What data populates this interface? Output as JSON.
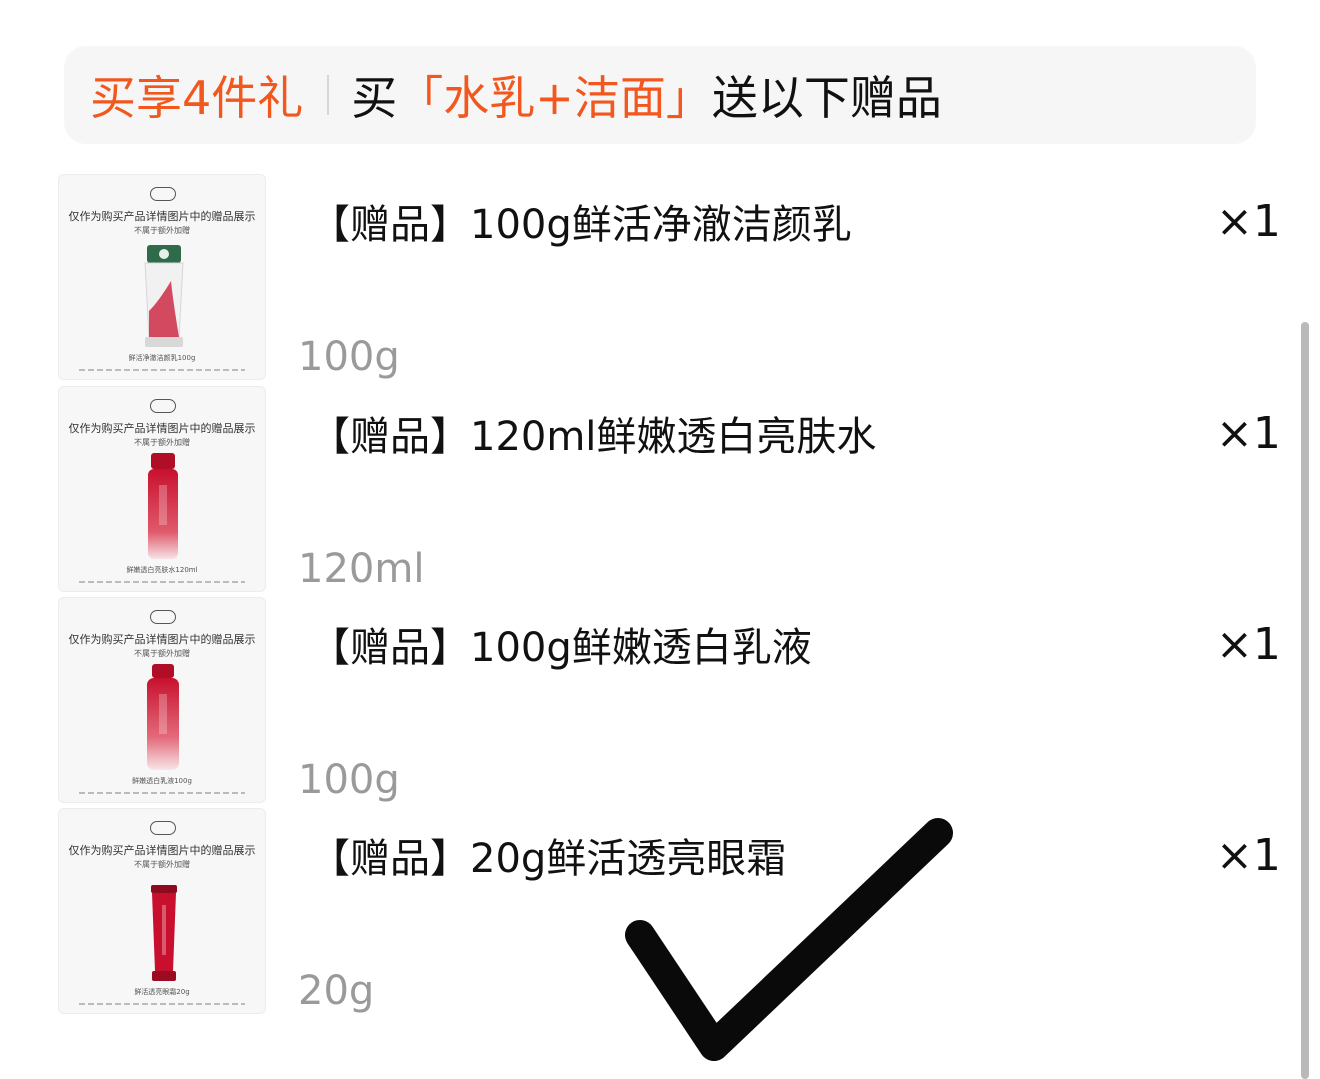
{
  "banner": {
    "label": "买享4件礼",
    "prefix": "买",
    "bracket_open": "「",
    "products": "水乳+洁面",
    "bracket_close": " 」",
    "suffix": "送以下赠品"
  },
  "gifts": [
    {
      "name": "【赠品】100g鲜活净澈洁颜乳",
      "quantity": "×1",
      "spec": "100g",
      "thumb_note": "仅作为购买产品详情图片中的赠品展示",
      "thumb_sub": "不属于额外加赠",
      "thumb_caption": "鲜活净澈洁颜乳100g"
    },
    {
      "name": "【赠品】120ml鲜嫩透白亮肤水",
      "quantity": "×1",
      "spec": "120ml",
      "thumb_note": "仅作为购买产品详情图片中的赠品展示",
      "thumb_sub": "不属于额外加赠",
      "thumb_caption": "鲜嫩透白亮肤水120ml"
    },
    {
      "name": "【赠品】100g鲜嫩透白乳液",
      "quantity": "×1",
      "spec": "100g",
      "thumb_note": "仅作为购买产品详情图片中的赠品展示",
      "thumb_sub": "不属于额外加赠",
      "thumb_caption": "鲜嫩透白乳液100g"
    },
    {
      "name": "【赠品】20g鲜活透亮眼霜",
      "quantity": "×1",
      "spec": "20g",
      "thumb_note": "仅作为购买产品详情图片中的赠品展示",
      "thumb_sub": "不属于额外加赠",
      "thumb_caption": "鲜活透亮眼霜20g"
    }
  ],
  "colors": {
    "accent": "#f2571e",
    "product_red": "#c8102e",
    "spec_gray": "#9a9a9a"
  },
  "icons": [
    "checkmark-icon"
  ]
}
